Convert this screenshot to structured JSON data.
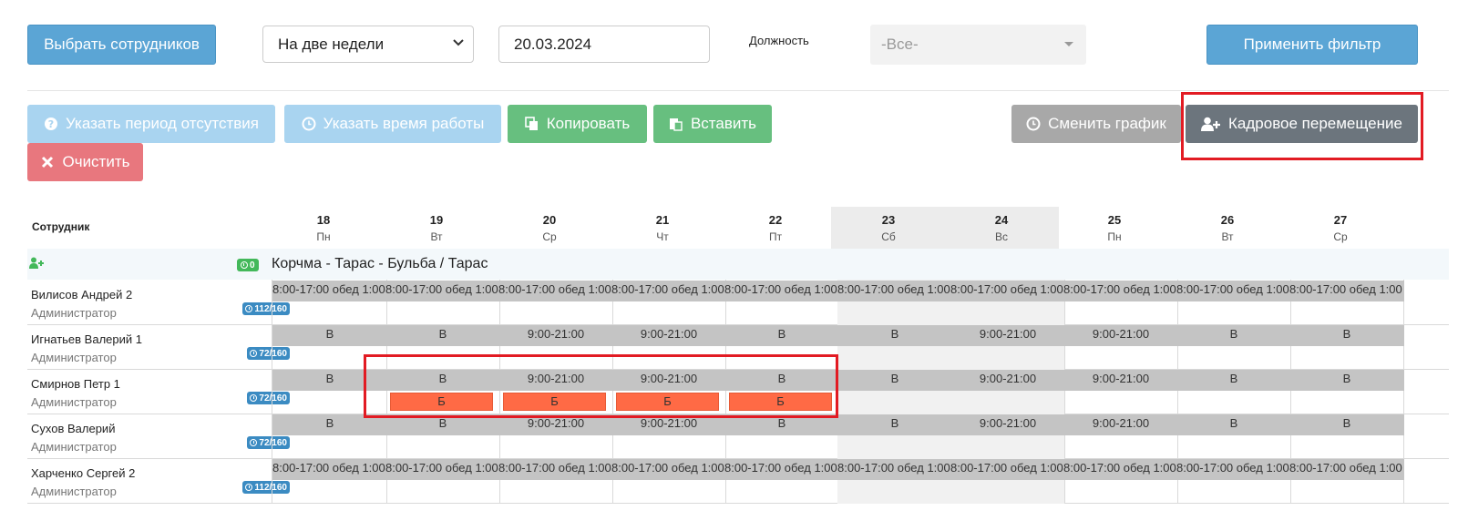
{
  "filter": {
    "select_employees_label": "Выбрать сотрудников",
    "period_value": "На две недели",
    "date_value": "20.03.2024",
    "position_label": "Должность",
    "position_value": "-Все-",
    "apply_label": "Применить фильтр"
  },
  "actions": {
    "absence_label": "Указать период отсутствия",
    "worktime_label": "Указать время работы",
    "copy_label": "Копировать",
    "paste_label": "Вставить",
    "clear_label": "Очистить",
    "change_schedule_label": "Сменить график",
    "transfer_label": "Кадровое перемещение"
  },
  "colors": {
    "primary": "#5ba5d5",
    "success": "#67bf7f",
    "danger": "#e8777e",
    "sick": "#ff6a45",
    "highlight": "#e21b23"
  },
  "icons": {
    "absence": "question-circle-icon",
    "worktime": "clock-icon",
    "copy": "copy-icon",
    "paste": "paste-icon",
    "clear": "close-icon",
    "change_schedule": "clock-icon",
    "transfer": "user-plus-icon"
  },
  "table": {
    "employee_header": "Сотрудник",
    "days": [
      {
        "num": "18",
        "dow": "Пн",
        "weekend": false
      },
      {
        "num": "19",
        "dow": "Вт",
        "weekend": false
      },
      {
        "num": "20",
        "dow": "Ср",
        "weekend": false
      },
      {
        "num": "21",
        "dow": "Чт",
        "weekend": false
      },
      {
        "num": "22",
        "dow": "Пт",
        "weekend": false
      },
      {
        "num": "23",
        "dow": "Сб",
        "weekend": true
      },
      {
        "num": "24",
        "dow": "Вс",
        "weekend": true
      },
      {
        "num": "25",
        "dow": "Пн",
        "weekend": false
      },
      {
        "num": "26",
        "dow": "Вт",
        "weekend": false
      },
      {
        "num": "27",
        "dow": "Ср",
        "weekend": false
      }
    ],
    "group": {
      "title": "Корчма - Тарас - Бульба / Тарас",
      "badge": "0"
    },
    "employees": [
      {
        "name": "Вилисов Андрей 2",
        "position": "Администратор",
        "hours": "112/160",
        "cells": [
          "8:00-17:00 обед 1:00",
          "8:00-17:00 обед 1:00",
          "8:00-17:00 обед 1:00",
          "8:00-17:00 обед 1:00",
          "8:00-17:00 обед 1:00",
          "8:00-17:00 обед 1:00",
          "8:00-17:00 обед 1:00",
          "8:00-17:00 обед 1:00",
          "8:00-17:00 обед 1:00",
          "8:00-17:00 обед 1:00"
        ],
        "marks": [
          "",
          "",
          "",
          "",
          "",
          "",
          "",
          "",
          "",
          ""
        ]
      },
      {
        "name": "Игнатьев Валерий 1",
        "position": "Администратор",
        "hours": "72/160",
        "cells": [
          "В",
          "В",
          "9:00-21:00",
          "9:00-21:00",
          "В",
          "В",
          "9:00-21:00",
          "9:00-21:00",
          "В",
          "В"
        ],
        "marks": [
          "",
          "",
          "",
          "",
          "",
          "",
          "",
          "",
          "",
          ""
        ]
      },
      {
        "name": "Смирнов Петр 1",
        "position": "Администратор",
        "hours": "72/160",
        "cells": [
          "В",
          "В",
          "9:00-21:00",
          "9:00-21:00",
          "В",
          "В",
          "9:00-21:00",
          "9:00-21:00",
          "В",
          "В"
        ],
        "marks": [
          "",
          "Б",
          "Б",
          "Б",
          "Б",
          "",
          "",
          "",
          "",
          ""
        ]
      },
      {
        "name": "Сухов Валерий",
        "position": "Администратор",
        "hours": "72/160",
        "cells": [
          "В",
          "В",
          "9:00-21:00",
          "9:00-21:00",
          "В",
          "В",
          "9:00-21:00",
          "9:00-21:00",
          "В",
          "В"
        ],
        "marks": [
          "",
          "",
          "",
          "",
          "",
          "",
          "",
          "",
          "",
          ""
        ]
      },
      {
        "name": "Харченко Сергей 2",
        "position": "Администратор",
        "hours": "112/160",
        "cells": [
          "8:00-17:00 обед 1:00",
          "8:00-17:00 обед 1:00",
          "8:00-17:00 обед 1:00",
          "8:00-17:00 обед 1:00",
          "8:00-17:00 обед 1:00",
          "8:00-17:00 обед 1:00",
          "8:00-17:00 обед 1:00",
          "8:00-17:00 обед 1:00",
          "8:00-17:00 обед 1:00",
          "8:00-17:00 обед 1:00"
        ],
        "marks": [
          "",
          "",
          "",
          "",
          "",
          "",
          "",
          "",
          "",
          ""
        ]
      }
    ]
  }
}
